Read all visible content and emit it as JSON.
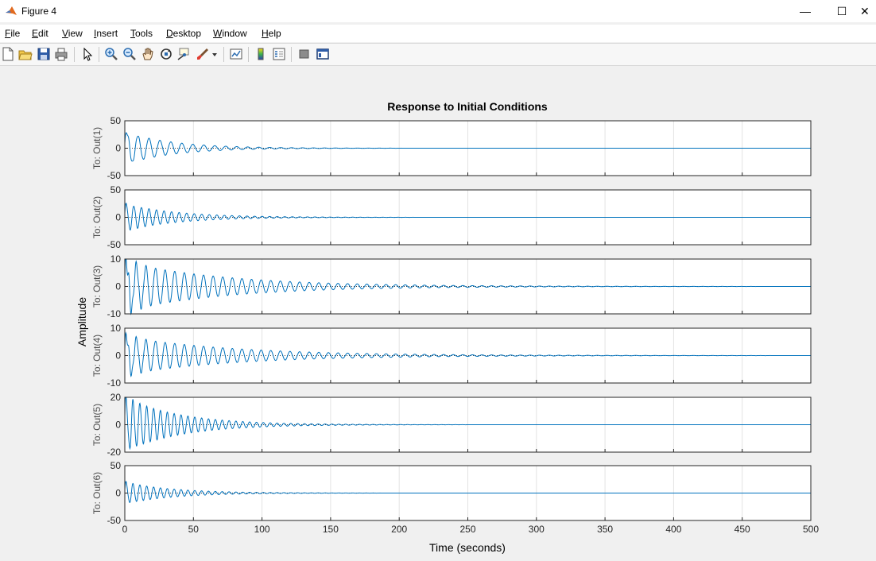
{
  "window": {
    "title": "Figure 4",
    "minimize_glyph": "—",
    "maximize_glyph": "☐",
    "close_glyph": "✕"
  },
  "menu": [
    "File",
    "Edit",
    "View",
    "Insert",
    "Tools",
    "Desktop",
    "Window",
    "Help"
  ],
  "toolbar": {
    "icons": [
      "new-figure-icon",
      "open-file-icon",
      "save-icon",
      "print-icon",
      "select-arrow-icon",
      "zoom-in-icon",
      "zoom-out-icon",
      "pan-hand-icon",
      "rotate-3d-icon",
      "data-cursor-icon",
      "brush-icon",
      "brush-dropdown-icon",
      "link-plot-icon",
      "colorbar-icon",
      "legend-icon",
      "hide-plot-tools-icon",
      "show-plot-tools-icon"
    ]
  },
  "chart_data": {
    "type": "line",
    "title": "Response to Initial Conditions",
    "xlabel": "Time (seconds)",
    "ylabel": "Amplitude",
    "xlim": [
      0,
      500
    ],
    "xticks": [
      0,
      50,
      100,
      150,
      200,
      250,
      300,
      350,
      400,
      450,
      500
    ],
    "grid": true,
    "line_color": "#0072bd",
    "subplots": [
      {
        "ylabel": "To: Out(1)",
        "ylim": [
          -50,
          50
        ],
        "yticks": [
          -50,
          0,
          50
        ],
        "amp": 30,
        "period": 8,
        "decay": 35
      },
      {
        "ylabel": "To: Out(2)",
        "ylim": [
          -50,
          50
        ],
        "yticks": [
          -50,
          0,
          50
        ],
        "amp": 25,
        "period": 5.5,
        "decay": 38
      },
      {
        "ylabel": "To: Out(3)",
        "ylim": [
          -10,
          10
        ],
        "yticks": [
          -10,
          0,
          10
        ],
        "amp": 9,
        "period": 7,
        "decay": 75
      },
      {
        "ylabel": "To: Out(4)",
        "ylim": [
          -10,
          10
        ],
        "yticks": [
          -10,
          0,
          10
        ],
        "amp": 7,
        "period": 7,
        "decay": 80
      },
      {
        "ylabel": "To: Out(5)",
        "ylim": [
          -20,
          20
        ],
        "yticks": [
          -20,
          0,
          20
        ],
        "amp": 20,
        "period": 5,
        "decay": 40
      },
      {
        "ylabel": "To: Out(6)",
        "ylim": [
          -50,
          50
        ],
        "yticks": [
          -50,
          0,
          50
        ],
        "amp": 20,
        "period": 5,
        "decay": 35
      }
    ]
  }
}
